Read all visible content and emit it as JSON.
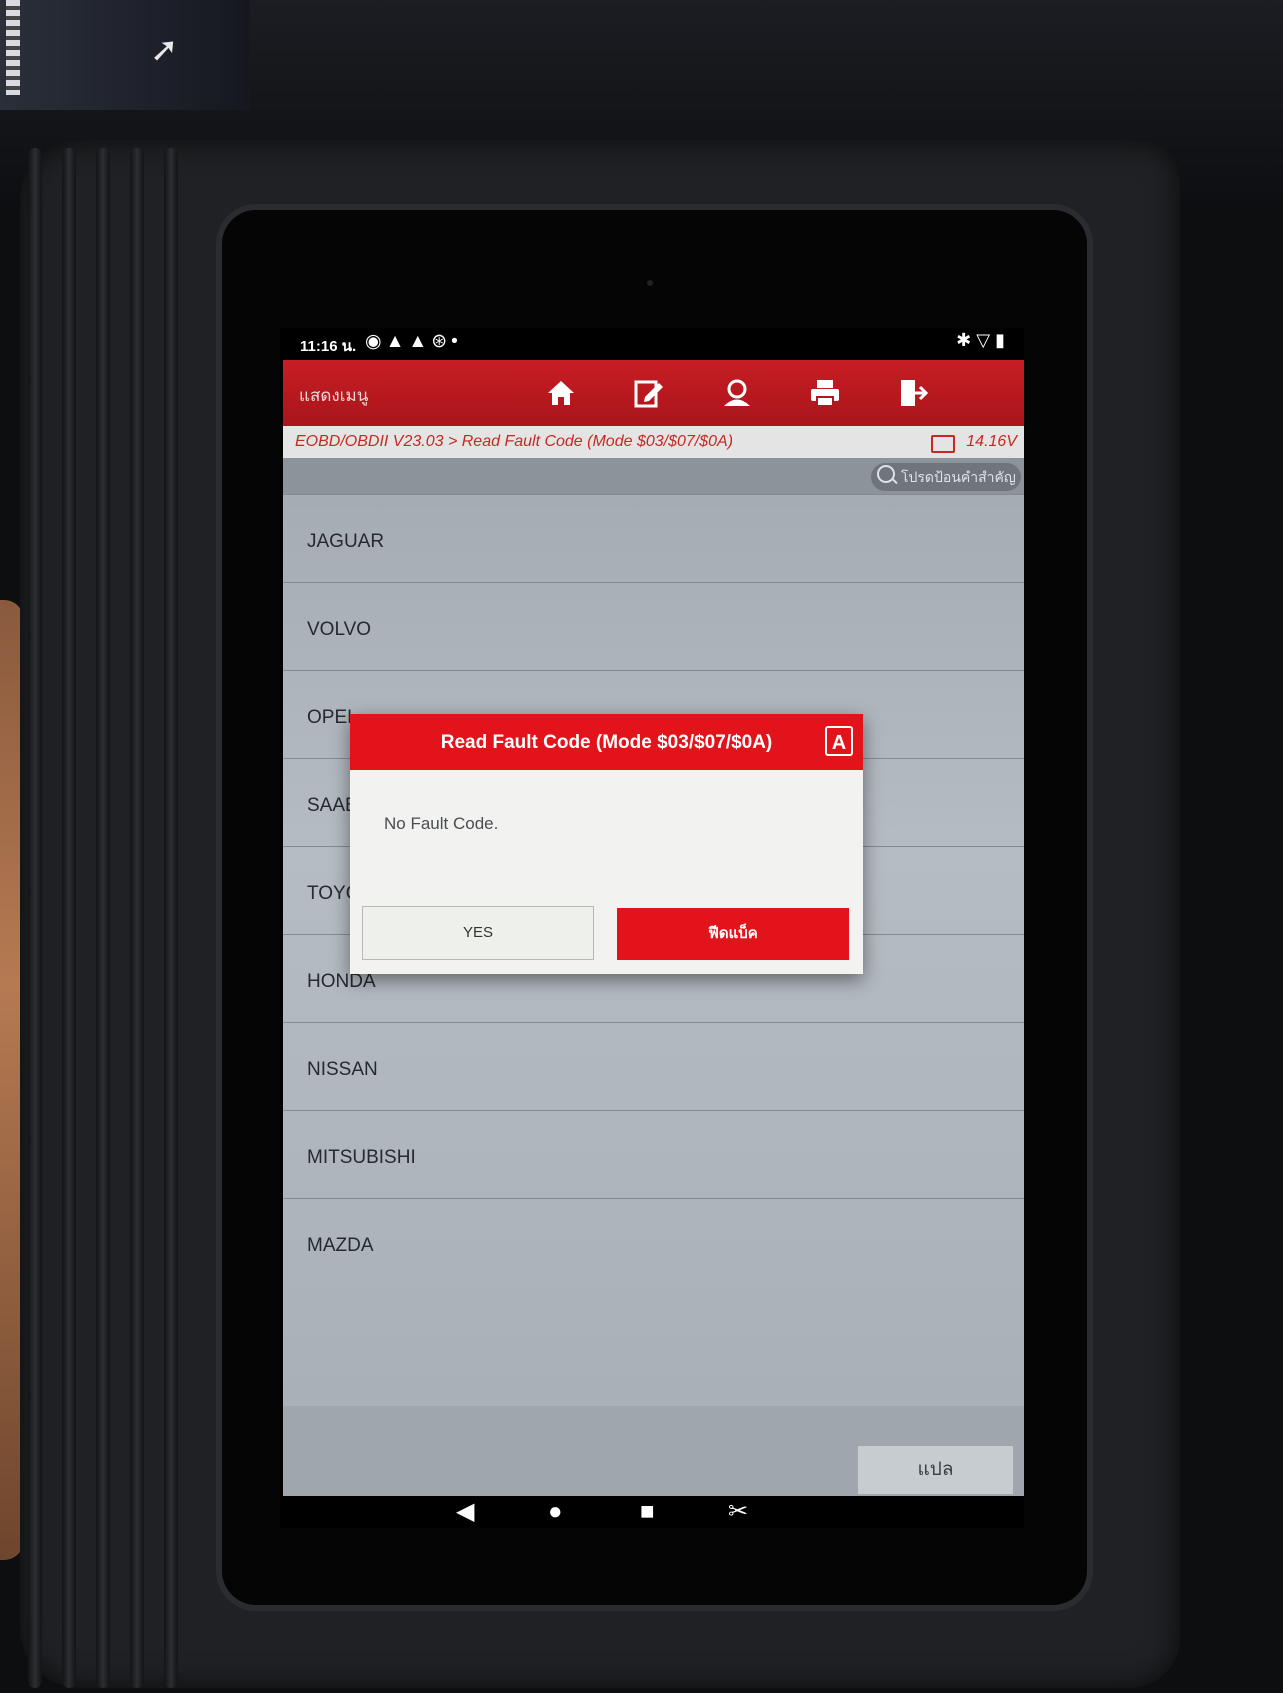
{
  "status_bar": {
    "time": "11:16 น.",
    "left_icons": "◉▲▲⊛•",
    "right_icons": "✱▽▮"
  },
  "toolbar": {
    "title": "แสดงเมนู",
    "icons": [
      "home-icon",
      "edit-report-icon",
      "user-icon",
      "print-icon",
      "exit-icon"
    ]
  },
  "breadcrumb": {
    "path": "EOBD/OBDII V23.03 > Read Fault Code (Mode $03/$07/$0A)",
    "voltage": "14.16V"
  },
  "search": {
    "placeholder": "โปรดป้อนคำสำคัญ"
  },
  "list": {
    "items": [
      "JAGUAR",
      "VOLVO",
      "OPEL",
      "SAAB",
      "TOYOTA",
      "HONDA",
      "NISSAN",
      "MITSUBISHI",
      "MAZDA"
    ]
  },
  "footer": {
    "back_label": "แปล"
  },
  "dialog": {
    "title": "Read Fault Code (Mode $03/$07/$0A)",
    "icon_letter": "A",
    "message": "No Fault Code.",
    "yes_label": "YES",
    "feedback_label": "ฟีดแบ็ค"
  },
  "colors": {
    "brand_red": "#c81d24",
    "dialog_red": "#e3131b",
    "list_bg": "#a5acb4"
  }
}
